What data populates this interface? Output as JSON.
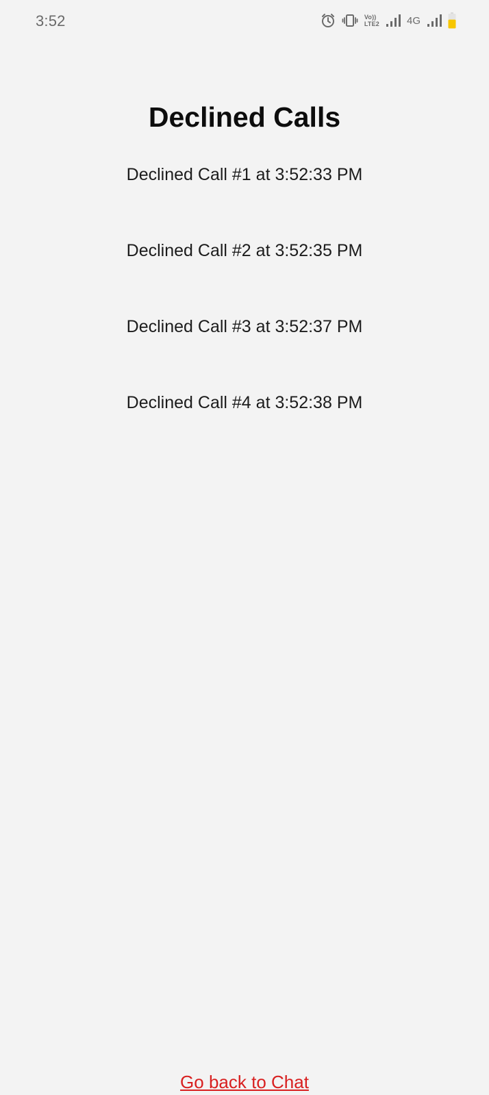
{
  "status_bar": {
    "time": "3:52",
    "network_label": "4G",
    "volte_top": "Vo))",
    "volte_bottom": "LTE2",
    "icons": [
      "alarm-icon",
      "vibrate-icon",
      "volte-icon",
      "signal-icon",
      "signal-icon",
      "battery-icon"
    ],
    "battery_color": "#f7c600",
    "battery_level": 0.6
  },
  "page": {
    "title": "Declined Calls",
    "calls": [
      "Declined Call #1 at 3:52:33 PM",
      "Declined Call #2 at 3:52:35 PM",
      "Declined Call #3 at 3:52:37 PM",
      "Declined Call #4 at 3:52:38 PM"
    ],
    "back_link": "Go back to Chat"
  },
  "colors": {
    "background": "#f3f3f3",
    "link": "#d81f1f",
    "title": "#0d0d0d"
  }
}
